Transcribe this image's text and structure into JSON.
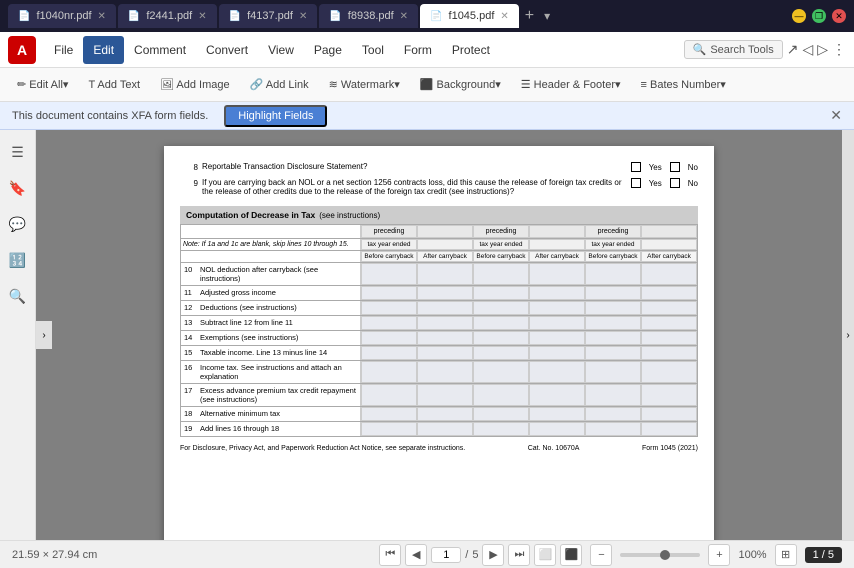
{
  "titlebar": {
    "tabs": [
      {
        "id": "tab1",
        "label": "f1040nr.pdf",
        "active": false
      },
      {
        "id": "tab2",
        "label": "f2441.pdf",
        "active": false
      },
      {
        "id": "tab3",
        "label": "f4137.pdf",
        "active": false
      },
      {
        "id": "tab4",
        "label": "f8938.pdf",
        "active": false
      },
      {
        "id": "tab5",
        "label": "f1045.pdf",
        "active": true
      }
    ],
    "win_min": "—",
    "win_max": "❐",
    "win_close": "✕"
  },
  "menubar": {
    "logo": "A",
    "items": [
      {
        "label": "File",
        "active": false
      },
      {
        "label": "Edit",
        "active": true
      },
      {
        "label": "Comment",
        "active": false
      },
      {
        "label": "Convert",
        "active": false
      },
      {
        "label": "View",
        "active": false
      },
      {
        "label": "Page",
        "active": false
      },
      {
        "label": "Tool",
        "active": false
      },
      {
        "label": "Form",
        "active": false
      },
      {
        "label": "Protect",
        "active": false
      }
    ],
    "search_placeholder": "Search Tools"
  },
  "toolbar": {
    "buttons": [
      {
        "label": "✏ Edit All▾"
      },
      {
        "label": "T Add Text"
      },
      {
        "label": "🖼 Add Image"
      },
      {
        "label": "🔗 Add Link"
      },
      {
        "label": "≋ Watermark▾"
      },
      {
        "label": "⬛ Background▾"
      },
      {
        "label": "☰ Header & Footer▾"
      },
      {
        "label": "≡ Bates Number▾"
      }
    ]
  },
  "notification": {
    "text": "This document contains XFA form fields.",
    "button_label": "Highlight Fields",
    "close": "✕"
  },
  "sidebar": {
    "icons": [
      "☰",
      "🔖",
      "💬",
      "🔢",
      "🔍"
    ]
  },
  "pdf": {
    "line8": {
      "num": "8",
      "text": "Reportable Transaction Disclosure Statement?",
      "yes": "Yes",
      "no": "No"
    },
    "line9": {
      "num": "9",
      "text": "If you are carrying back an NOL or a net section 1256 contracts loss, did this cause the release of foreign tax credits or the release of other credits due to the release of the foreign tax credit (see instructions)?",
      "yes": "Yes",
      "no": "No"
    },
    "computation": {
      "title": "Computation of Decrease in Tax",
      "subtitle": "(see instructions)",
      "preceding_label": "preceding",
      "tax_year_ended": "tax year ended",
      "before_carryback": "Before carryback",
      "after_carryback": "After carryback",
      "note": "Note: If 1a and 1c are blank, skip lines 10 through 15."
    },
    "lines": [
      {
        "num": "10",
        "label": "NOL deduction after carryback (see instructions)"
      },
      {
        "num": "11",
        "label": "Adjusted gross income"
      },
      {
        "num": "12",
        "label": "Deductions (see instructions)"
      },
      {
        "num": "13",
        "label": "Subtract line 12 from line 11"
      },
      {
        "num": "14",
        "label": "Exemptions (see instructions)"
      },
      {
        "num": "15",
        "label": "Taxable income. Line 13 minus line 14"
      },
      {
        "num": "16",
        "label": "Income tax. See instructions and attach an explanation"
      },
      {
        "num": "17",
        "label": "Excess advance premium tax credit repayment (see instructions)"
      },
      {
        "num": "18",
        "label": "Alternative minimum tax"
      },
      {
        "num": "19",
        "label": "Add lines 16 through 18"
      }
    ],
    "footer_left": "For Disclosure, Privacy Act, and Paperwork Reduction Act Notice, see separate instructions.",
    "footer_cat": "Cat. No. 10670A",
    "footer_form": "Form 1045 (2021)"
  },
  "statusbar": {
    "dimensions": "21.59 × 27.94 cm",
    "page_current": "1",
    "page_total": "5",
    "page_display": "1 / 5",
    "zoom": "100%",
    "nav_first": "⏮",
    "nav_prev": "◀",
    "nav_next": "▶",
    "nav_last": "⏭"
  }
}
